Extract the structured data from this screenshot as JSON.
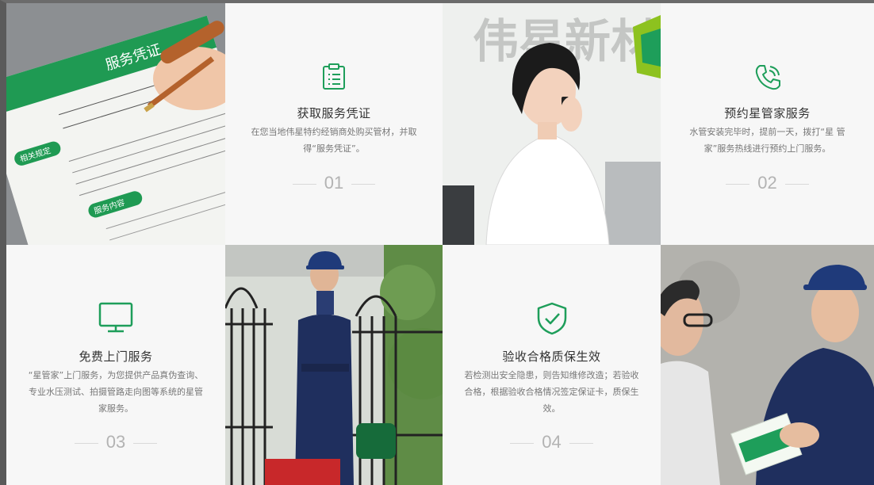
{
  "cards": [
    {
      "title": "获取服务凭证",
      "desc": "在您当地伟星特约经销商处购买管材，并取得“服务凭证”。",
      "num": "01",
      "icon": "clipboard-icon"
    },
    {
      "title": "预约星管家服务",
      "desc": "水管安装完毕时，提前一天，拨打“星 管 家”服务热线进行预约上门服务。",
      "num": "02",
      "icon": "phone-icon"
    },
    {
      "title": "免费上门服务",
      "desc": "“星管家”上门服务，为您提供产品真伪查询、专业水压测试、拍摄管路走向图等系统的星管家服务。",
      "num": "03",
      "icon": "monitor-icon"
    },
    {
      "title": "验收合格质保生效",
      "desc": "若检测出安全隐患，则告知维修改造；若验收合格，根据验收合格情况签定保证卡，质保生效。",
      "num": "04",
      "icon": "shield-check-icon"
    }
  ],
  "photos": {
    "certificate": {
      "header": "服务凭证",
      "tag1": "相关规定",
      "tag2": "服务内容"
    },
    "office_wall": "伟星新材"
  },
  "colors": {
    "accent": "#1e9e5a",
    "card_bg": "#f7f7f7",
    "uniform": "#1f2f5e"
  }
}
